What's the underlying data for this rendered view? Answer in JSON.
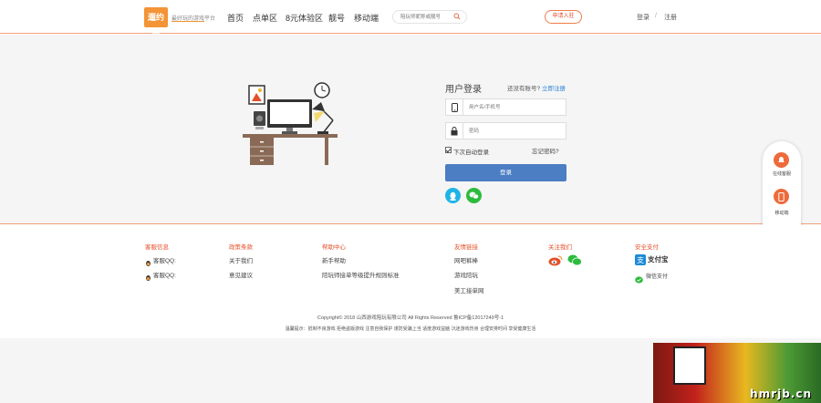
{
  "header": {
    "logo_text": "遛约团",
    "slogan": "最好玩的游戏平台",
    "nav": [
      "首页",
      "点单区",
      "8元体验区",
      "靓号",
      "移动端"
    ],
    "search_placeholder": "陪玩师昵称或靓号",
    "apply_label": "申请入驻",
    "login_link": "登录",
    "separator": "/",
    "register_link": "注册"
  },
  "login": {
    "title": "用户登录",
    "no_account": "还没有账号?",
    "register_now": "立即注册",
    "username_placeholder": "用户名/手机号",
    "password_placeholder": "密码",
    "auto_login": "下次自动登录",
    "forgot": "忘记密码?",
    "submit": "登录",
    "qq_icon": "qq-icon",
    "wechat_icon": "wechat-icon"
  },
  "side": {
    "service": "在线客服",
    "mobile": "移动端",
    "top_icon": "arrow-up-icon"
  },
  "footer": {
    "cols": [
      {
        "head": "客服信息",
        "items": [
          "客服QQ:",
          "客服QQ:"
        ]
      },
      {
        "head": "政策条款",
        "items": [
          "关于我们",
          "意见建议"
        ]
      },
      {
        "head": "帮助中心",
        "items": [
          "新手帮助",
          "陪玩师接单等级提升规则标准"
        ]
      },
      {
        "head": "友情链接",
        "items": [
          "网吧裤棒",
          "游戏陪玩",
          "美工接单网"
        ]
      },
      {
        "head": "关注我们",
        "items": []
      },
      {
        "head": "安全支付",
        "items": [
          "微信支付"
        ]
      }
    ],
    "alipay": "支付宝",
    "copyright": "Copyright© 2018 山西游戏陪玩有限公司 All Rights Reserved 鲁ICP备12017249号-1",
    "notice": "温馨提示：抵制不良游戏 拒绝盗版游戏 注意自我保护 谨防受骗上当 适度游戏益脑 沉迷游戏伤身 合理安排时间 享受健康生活"
  },
  "watermark": {
    "text": "hmrjb.cn"
  },
  "colors": {
    "accent": "#e4502a",
    "primary_button": "#4b7ec3",
    "logo": "#f39436",
    "qq": "#1fb4e6",
    "wechat": "#2dbb3d"
  }
}
